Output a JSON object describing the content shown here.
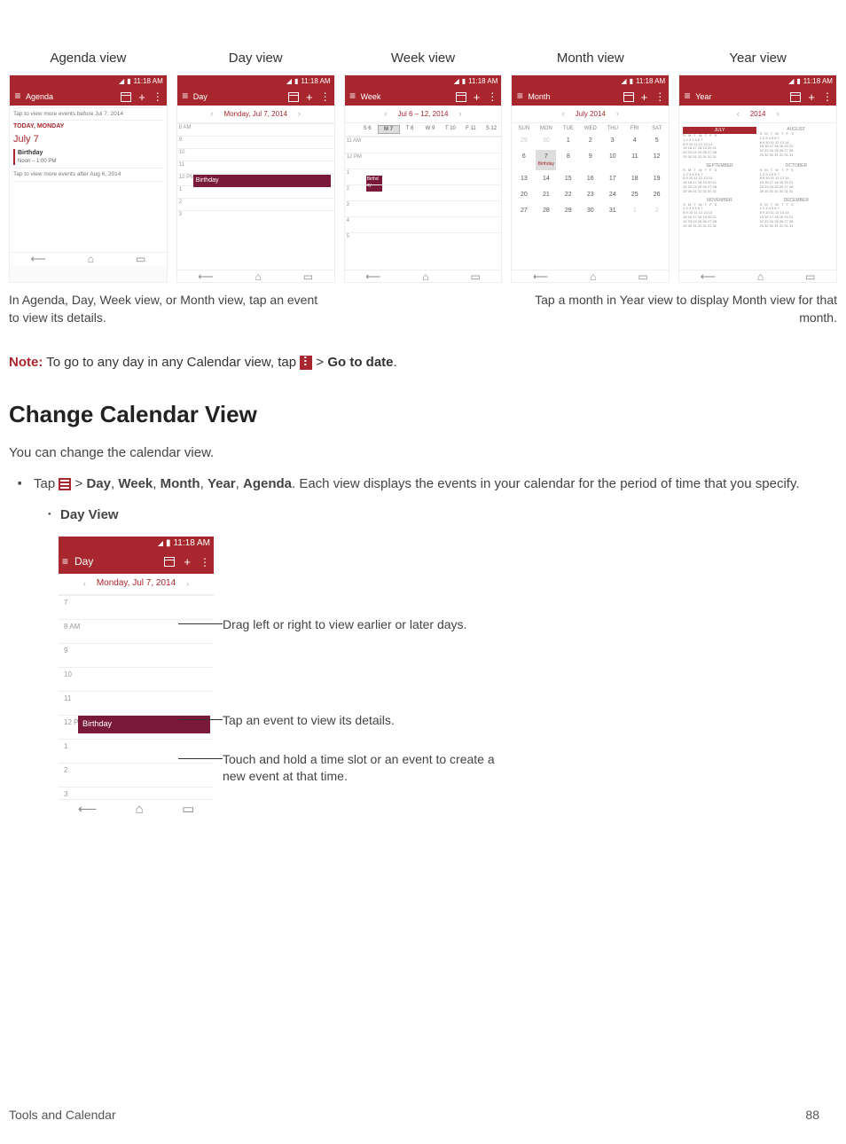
{
  "views": {
    "agenda": {
      "label": "Agenda view",
      "title": "Agenda",
      "time": "11:18 AM",
      "before_text": "Tap to view more events before Jul 7, 2014",
      "today_label": "TODAY, MONDAY",
      "today_date": "July 7",
      "event_title": "Birthday",
      "event_time": "Noon – 1:00 PM",
      "after_text": "Tap to view more events after Aug 6, 2014"
    },
    "day": {
      "label": "Day view",
      "title": "Day",
      "time": "11:18 AM",
      "date": "Monday, Jul 7, 2014",
      "hours": [
        "8\nAM",
        "9",
        "10",
        "11",
        "12\nPM",
        "1",
        "2",
        "3"
      ],
      "event": "Birthday"
    },
    "week": {
      "label": "Week view",
      "title": "Week",
      "time": "11:18 AM",
      "range": "Jul 6 – 12, 2014",
      "days": [
        "S 6",
        "M 7",
        "T 8",
        "W 9",
        "T 10",
        "F 11",
        "S 12"
      ],
      "hours": [
        "11\nAM",
        "12\nPM",
        "1",
        "2",
        "3",
        "4",
        "5"
      ],
      "event": "Birthd\nay"
    },
    "month": {
      "label": "Month view",
      "title": "Month",
      "time": "11:18 AM",
      "range": "July 2014",
      "day_headers": [
        "SUN",
        "MON",
        "TUE",
        "WED",
        "THU",
        "FRI",
        "SAT"
      ],
      "weeks": [
        [
          "29",
          "30",
          "1",
          "2",
          "3",
          "4",
          "5"
        ],
        [
          "6",
          "7",
          "8",
          "9",
          "10",
          "11",
          "12"
        ],
        [
          "13",
          "14",
          "15",
          "16",
          "17",
          "18",
          "19"
        ],
        [
          "20",
          "21",
          "22",
          "23",
          "24",
          "25",
          "26"
        ],
        [
          "27",
          "28",
          "29",
          "30",
          "31",
          "1",
          "2"
        ]
      ],
      "selected_day": "7",
      "event_label": "Birthday"
    },
    "year": {
      "label": "Year view",
      "title": "Year",
      "time": "11:18 AM",
      "range": "2014",
      "months": [
        "JULY",
        "AUGUST",
        "SEPTEMBER",
        "OCTOBER",
        "NOVEMBER",
        "DECEMBER"
      ],
      "day_row": "S M T W T F S"
    }
  },
  "captions": {
    "left": "In Agenda, Day, Week view, or Month view, tap an event to view its details.",
    "right": "Tap a month in Year view to display Month view for that month."
  },
  "note": {
    "label": "Note:",
    "pre": " To go to any day in any Calendar view, tap ",
    "gt": " > ",
    "action": "Go to date",
    "post": "."
  },
  "section": {
    "heading": "Change Calendar View",
    "intro": "You can change the calendar view.",
    "step_pre": "Tap ",
    "step_gt": " > ",
    "step_views": [
      "Day",
      "Week",
      "Month",
      "Year",
      "Agenda"
    ],
    "step_post": ". Each view displays the events in your calendar for the period of time that you specify.",
    "sub_label": "Day View"
  },
  "detail": {
    "title": "Day",
    "time": "11:18 AM",
    "date": "Monday, Jul 7, 2014",
    "hours": [
      "7",
      "8\nAM",
      "9",
      "10",
      "11",
      "12\nPM",
      "1",
      "2",
      "3"
    ],
    "event": "Birthday",
    "callouts": {
      "c1": "Drag left or right to view earlier or later days.",
      "c2": "Tap an event to view its details.",
      "c3": "Touch and hold a time slot or an event to create a new event at that time."
    }
  },
  "footer": {
    "left": "Tools and Calendar",
    "right": "88"
  }
}
